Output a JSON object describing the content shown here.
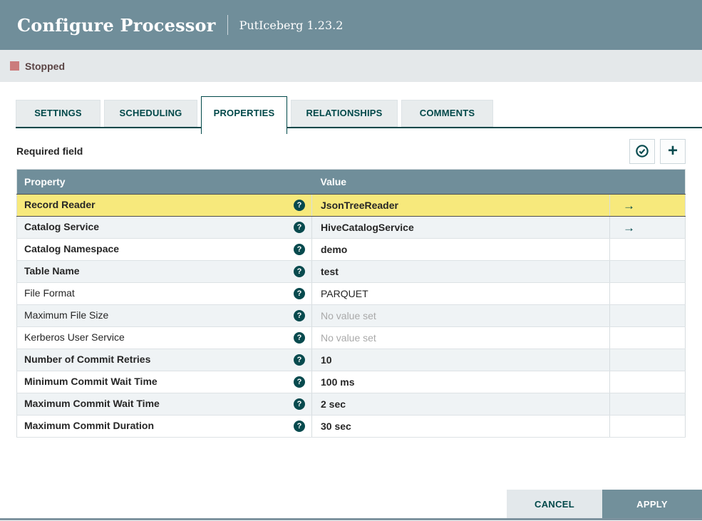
{
  "header": {
    "title": "Configure Processor",
    "subtitle": "PutIceberg 1.23.2"
  },
  "status": {
    "label": "Stopped",
    "color": "#cb7c7c"
  },
  "tabs": [
    {
      "label": "SETTINGS",
      "active": false
    },
    {
      "label": "SCHEDULING",
      "active": false
    },
    {
      "label": "PROPERTIES",
      "active": true
    },
    {
      "label": "RELATIONSHIPS",
      "active": false
    },
    {
      "label": "COMMENTS",
      "active": false
    }
  ],
  "toolbar": {
    "required_label": "Required field",
    "buttons": [
      {
        "icon": "verify-check-circle-icon"
      },
      {
        "icon": "add-property-plus-icon"
      }
    ]
  },
  "table": {
    "columns": [
      "Property",
      "Value",
      ""
    ],
    "help_icon": "question-mark-icon",
    "goto_icon": "right-arrow-icon",
    "goto_glyph": "→",
    "rows": [
      {
        "property": "Record Reader",
        "value": "JsonTreeReader",
        "bold": true,
        "unset": false,
        "selected": true,
        "has_arrow": true
      },
      {
        "property": "Catalog Service",
        "value": "HiveCatalogService",
        "bold": true,
        "unset": false,
        "selected": false,
        "has_arrow": true
      },
      {
        "property": "Catalog Namespace",
        "value": "demo",
        "bold": true,
        "unset": false,
        "selected": false,
        "has_arrow": false
      },
      {
        "property": "Table Name",
        "value": "test",
        "bold": true,
        "unset": false,
        "selected": false,
        "has_arrow": false
      },
      {
        "property": "File Format",
        "value": "PARQUET",
        "bold": false,
        "unset": false,
        "selected": false,
        "has_arrow": false
      },
      {
        "property": "Maximum File Size",
        "value": "No value set",
        "bold": false,
        "unset": true,
        "selected": false,
        "has_arrow": false
      },
      {
        "property": "Kerberos User Service",
        "value": "No value set",
        "bold": false,
        "unset": true,
        "selected": false,
        "has_arrow": false
      },
      {
        "property": "Number of Commit Retries",
        "value": "10",
        "bold": true,
        "unset": false,
        "selected": false,
        "has_arrow": false
      },
      {
        "property": "Minimum Commit Wait Time",
        "value": "100 ms",
        "bold": true,
        "unset": false,
        "selected": false,
        "has_arrow": false
      },
      {
        "property": "Maximum Commit Wait Time",
        "value": "2 sec",
        "bold": true,
        "unset": false,
        "selected": false,
        "has_arrow": false
      },
      {
        "property": "Maximum Commit Duration",
        "value": "30 sec",
        "bold": true,
        "unset": false,
        "selected": false,
        "has_arrow": false
      }
    ],
    "help_glyph": "?"
  },
  "footer": {
    "cancel_label": "CANCEL",
    "apply_label": "APPLY"
  },
  "colors": {
    "header_bg": "#708e9a",
    "accent_teal": "#004849",
    "selected_row": "#f7e97c",
    "status_stopped": "#cb7c7c"
  }
}
